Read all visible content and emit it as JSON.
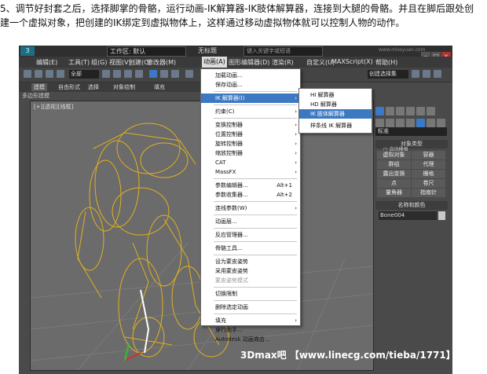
{
  "caption": {
    "line1": "5、调节好封套之后，选择脚掌的骨骼，运行动画-IK解算器-IK肢体解算器，连接到大腿的骨骼。并且在脚后跟处创",
    "line2": "建一个虚拟对象，把创建的IK绑定到虚拟物体上，这样通过移动虚拟物体就可以控制人物的动作。"
  },
  "titlebar": {
    "workspace": "工作区: 默认",
    "title": "无标题",
    "search_placeholder": "键入关键字或短语",
    "site_watermark": "www.missyuan.com"
  },
  "menubar": [
    "编辑(E)",
    "工具(T)",
    "组(G)",
    "视图(V)",
    "创建(C)",
    "修改器(M)",
    "动画(A)",
    "图形编辑器(D)",
    "渲染(R)",
    "自定义(U)",
    "MAXScript(X)",
    "帮助(H)"
  ],
  "toolbar": {
    "filter": "全部",
    "selection_set": "创建选择集"
  },
  "ribbon": {
    "tabs": [
      "建模",
      "自由形式",
      "选择",
      "对象绘制",
      "填充"
    ],
    "sublabel": "多边形建模"
  },
  "viewport": {
    "label": "[+][透视][线框]"
  },
  "animation_menu": [
    {
      "label": "加载动画...",
      "type": "item"
    },
    {
      "label": "保存动画...",
      "type": "item"
    },
    {
      "type": "sep"
    },
    {
      "label": "IK 解算器(I)",
      "type": "item",
      "arrow": true,
      "highlight": true
    },
    {
      "type": "sep"
    },
    {
      "label": "约束(C)",
      "type": "item",
      "arrow": true
    },
    {
      "type": "sep"
    },
    {
      "label": "变换控制器",
      "type": "item",
      "arrow": true
    },
    {
      "label": "位置控制器",
      "type": "item",
      "arrow": true
    },
    {
      "label": "旋转控制器",
      "type": "item",
      "arrow": true
    },
    {
      "label": "缩放控制器",
      "type": "item",
      "arrow": true
    },
    {
      "label": "CAT",
      "type": "item",
      "arrow": true
    },
    {
      "label": "MassFX",
      "type": "item",
      "arrow": true
    },
    {
      "type": "sep"
    },
    {
      "label": "参数编辑器...",
      "type": "item",
      "shortcut": "Alt+1"
    },
    {
      "label": "参数收集器...",
      "type": "item",
      "shortcut": "Alt+2"
    },
    {
      "type": "sep"
    },
    {
      "label": "连线参数(W)",
      "type": "item",
      "arrow": true
    },
    {
      "type": "sep"
    },
    {
      "label": "动画层...",
      "type": "item"
    },
    {
      "type": "sep"
    },
    {
      "label": "反应管理器...",
      "type": "item"
    },
    {
      "type": "sep"
    },
    {
      "label": "骨骼工具...",
      "type": "item"
    },
    {
      "type": "sep"
    },
    {
      "label": "设为蒙皮姿势",
      "type": "item"
    },
    {
      "label": "采用蒙皮姿势",
      "type": "item"
    },
    {
      "label": "蒙皮姿势模式",
      "type": "item",
      "disabled": true
    },
    {
      "type": "sep"
    },
    {
      "label": "切换限制",
      "type": "item"
    },
    {
      "type": "sep"
    },
    {
      "label": "删除选定动画",
      "type": "item"
    },
    {
      "type": "sep"
    },
    {
      "label": "填充",
      "type": "item",
      "arrow": true
    },
    {
      "label": "穿行助手...",
      "type": "item"
    },
    {
      "label": "Autodesk 动画商店...",
      "type": "item"
    }
  ],
  "ik_submenu": [
    {
      "label": "HI 解算器"
    },
    {
      "label": "HD 解算器"
    },
    {
      "label": "IK 肢体解算器",
      "highlight": true
    },
    {
      "label": "样条线 IK 解算器"
    }
  ],
  "command_panel": {
    "category": "标准",
    "object_type_header": "对象类型",
    "autogrid": "自动栅格",
    "buttons": [
      "虚拟对象",
      "容器",
      "群组",
      "代理",
      "露出变换",
      "栅格",
      "点",
      "卷尺",
      "量角器",
      "指南针"
    ],
    "name_color_header": "名称和颜色",
    "name_value": "Bone004"
  },
  "footer_watermark": "3Dmax吧 【www.linecg.com/tieba/1771】",
  "colors": {
    "highlight": "#3d78c3",
    "bone_wire": "#e0b020"
  }
}
